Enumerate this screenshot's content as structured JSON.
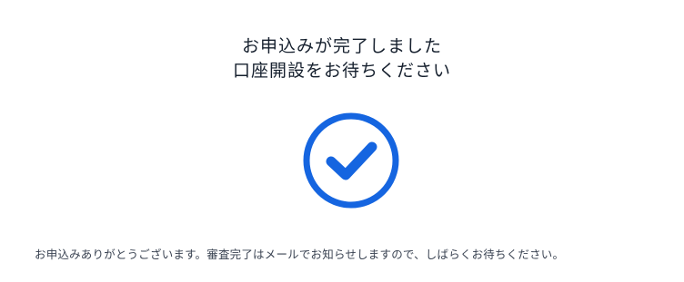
{
  "title": {
    "line1": "お申込みが完了しました",
    "line2": "口座開設をお待ちください"
  },
  "icon": {
    "name": "check-circle-icon",
    "color": "#1565e0"
  },
  "message": "お申込みありがとうございます。審査完了はメールでお知らせしますので、しばらくお待ちください。"
}
